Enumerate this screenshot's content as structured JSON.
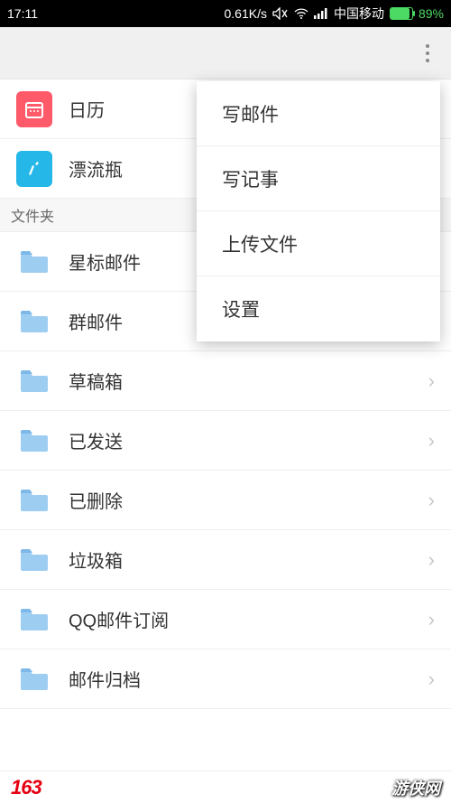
{
  "status": {
    "time": "17:11",
    "speed": "0.61K/s",
    "carrier": "中国移动",
    "battery_pct": "89%"
  },
  "section_header": "文件夹",
  "shortcuts": {
    "calendar": "日历",
    "bottle": "漂流瓶"
  },
  "folders": [
    {
      "label": "星标邮件"
    },
    {
      "label": "群邮件"
    },
    {
      "label": "草稿箱"
    },
    {
      "label": "已发送"
    },
    {
      "label": "已删除"
    },
    {
      "label": "垃圾箱"
    },
    {
      "label": "QQ邮件订阅"
    },
    {
      "label": "邮件归档"
    }
  ],
  "dropdown": {
    "compose": "写邮件",
    "note": "写记事",
    "upload": "上传文件",
    "settings": "设置"
  },
  "bottom": {
    "brand": "163",
    "watermark": "游侠网"
  }
}
